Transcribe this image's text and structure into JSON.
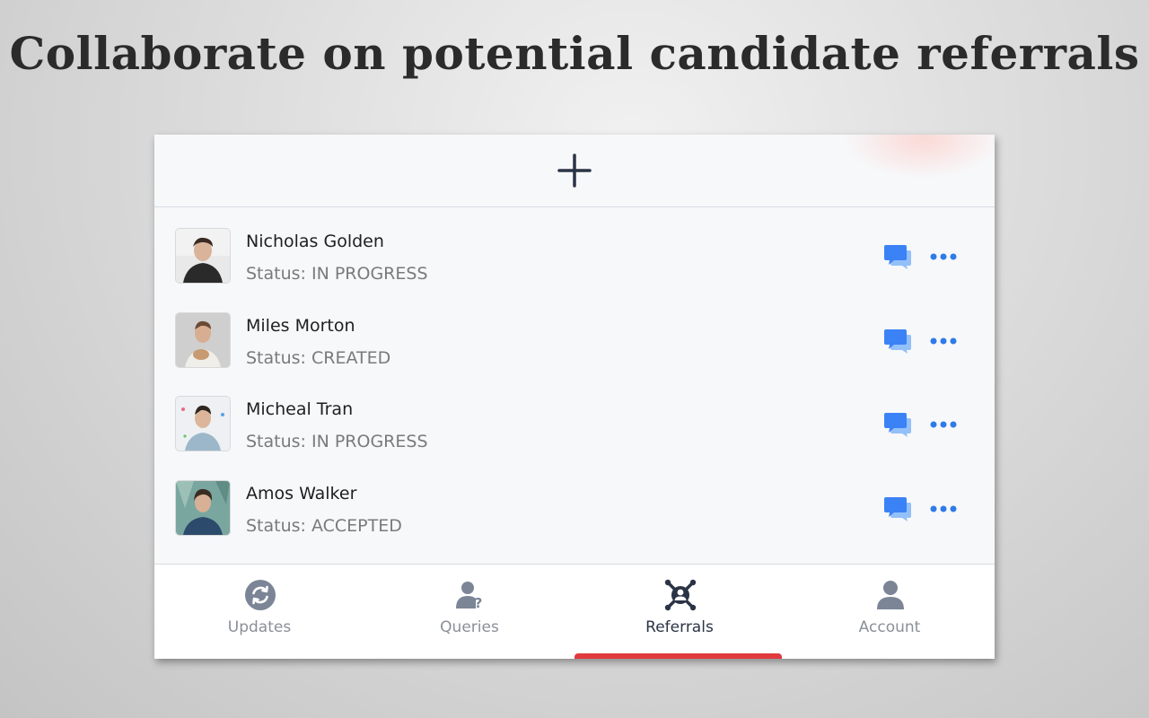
{
  "headline": "Collaborate on potential candidate referrals",
  "colors": {
    "accent": "#3b82f6",
    "tab_active_indicator": "#e0393e",
    "icon_dark": "#2b3446",
    "icon_muted": "#7b8596"
  },
  "add_button": {
    "icon": "plus-icon"
  },
  "referrals": [
    {
      "name": "Nicholas Golden",
      "status": "Status: IN PROGRESS",
      "chat_icon": "chat-icon",
      "more_icon": "more-dots-icon"
    },
    {
      "name": "Miles Morton",
      "status": "Status: CREATED",
      "chat_icon": "chat-icon",
      "more_icon": "more-dots-icon"
    },
    {
      "name": "Micheal Tran",
      "status": "Status: IN PROGRESS",
      "chat_icon": "chat-icon",
      "more_icon": "more-dots-icon"
    },
    {
      "name": "Amos Walker",
      "status": "Status: ACCEPTED",
      "chat_icon": "chat-icon",
      "more_icon": "more-dots-icon"
    }
  ],
  "tabs": [
    {
      "label": "Updates",
      "icon": "refresh-icon",
      "active": false
    },
    {
      "label": "Queries",
      "icon": "user-question-icon",
      "active": false
    },
    {
      "label": "Referrals",
      "icon": "referral-network-icon",
      "active": true
    },
    {
      "label": "Account",
      "icon": "account-icon",
      "active": false
    }
  ]
}
